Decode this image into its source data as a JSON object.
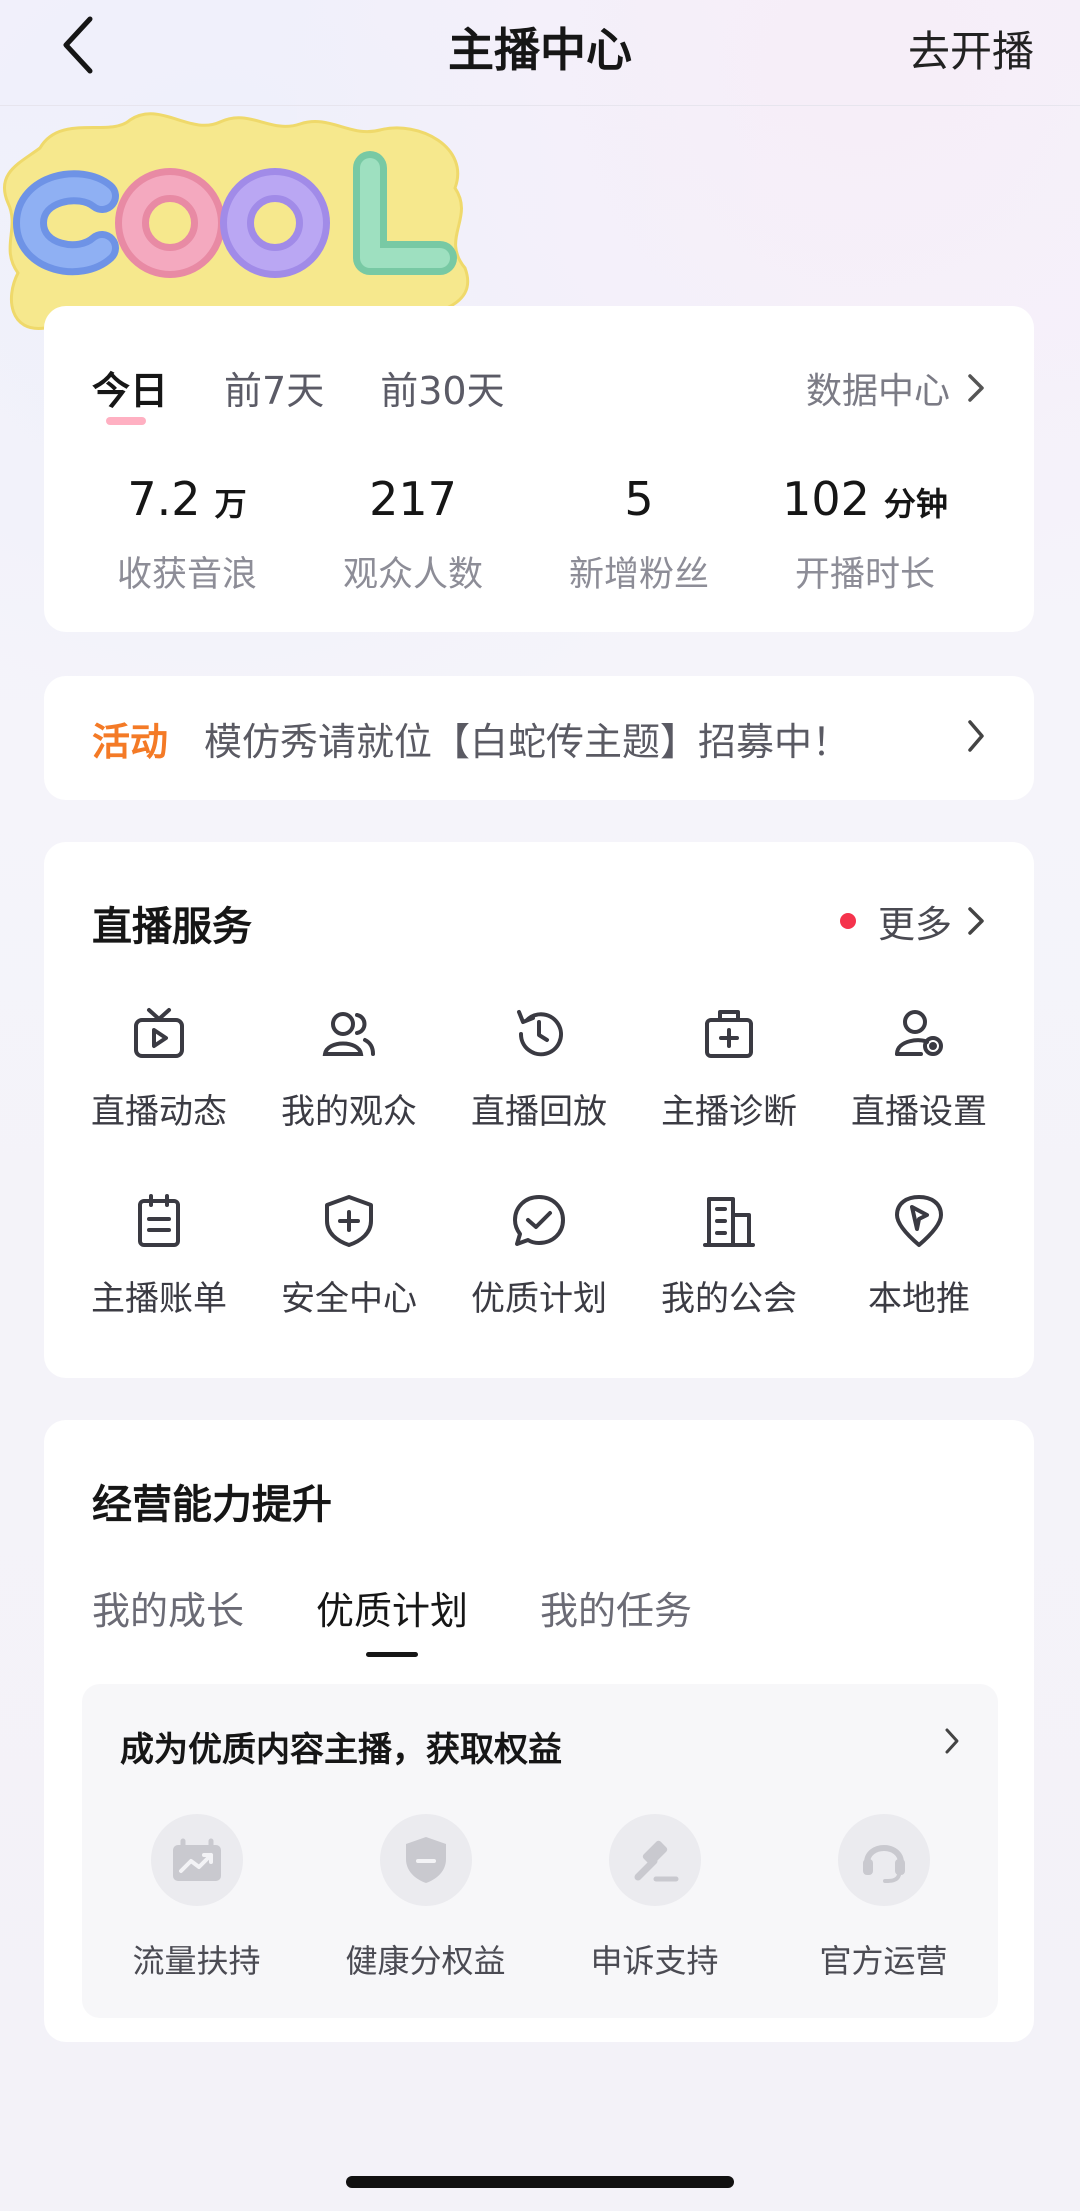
{
  "header": {
    "title": "主播中心",
    "action": "去开播"
  },
  "sticker": {
    "text": "COOL"
  },
  "stats": {
    "tabs": [
      "今日",
      "前7天",
      "前30天"
    ],
    "active_tab": "今日",
    "data_center": "数据中心",
    "items": [
      {
        "value": "7.2",
        "unit": "万",
        "label": "收获音浪"
      },
      {
        "value": "217",
        "unit": "",
        "label": "观众人数"
      },
      {
        "value": "5",
        "unit": "",
        "label": "新增粉丝"
      },
      {
        "value": "102",
        "unit": "分钟",
        "label": "开播时长"
      }
    ]
  },
  "activity": {
    "tag": "活动",
    "text": "模仿秀请就位【白蛇传主题】招募中！"
  },
  "services": {
    "title": "直播服务",
    "more": "更多",
    "items": [
      {
        "label": "直播动态",
        "icon": "tv-play-icon"
      },
      {
        "label": "我的观众",
        "icon": "audience-icon"
      },
      {
        "label": "直播回放",
        "icon": "history-clock-icon"
      },
      {
        "label": "主播诊断",
        "icon": "medical-kit-icon"
      },
      {
        "label": "直播设置",
        "icon": "user-settings-icon"
      },
      {
        "label": "主播账单",
        "icon": "bill-icon"
      },
      {
        "label": "安全中心",
        "icon": "shield-plus-icon"
      },
      {
        "label": "优质计划",
        "icon": "check-bubble-icon"
      },
      {
        "label": "我的公会",
        "icon": "building-icon"
      },
      {
        "label": "本地推",
        "icon": "location-pin-icon"
      }
    ]
  },
  "business": {
    "title": "经营能力提升",
    "tabs": [
      "我的成长",
      "优质计划",
      "我的任务"
    ],
    "active_tab": "优质计划",
    "panel_title": "成为优质内容主播，获取权益",
    "benefits": [
      {
        "label": "流量扶持",
        "icon": "traffic-chart-icon"
      },
      {
        "label": "健康分权益",
        "icon": "shield-icon"
      },
      {
        "label": "申诉支持",
        "icon": "gavel-icon"
      },
      {
        "label": "官方运营",
        "icon": "headset-icon"
      }
    ]
  },
  "colors": {
    "activity_accent": "#f47a26",
    "badge_dot": "#f5334c",
    "icon_stroke": "#3a3a42"
  }
}
